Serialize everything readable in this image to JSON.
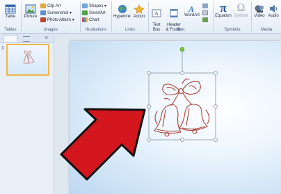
{
  "ribbon": {
    "tables": {
      "group": "Tables",
      "table": "Table"
    },
    "images": {
      "group": "Images",
      "picture": "Picture",
      "clip_art": "Clip Art",
      "screenshot": "Screenshot ▾",
      "photo_album": "Photo Album ▾"
    },
    "illustrations": {
      "group": "Illustrations",
      "shapes": "Shapes ▾",
      "smartart": "SmartArt",
      "chart": "Chart"
    },
    "links": {
      "group": "Links",
      "hyperlink": "Hyperlink",
      "action": "Action"
    },
    "text": {
      "group": "Text",
      "text_box": "Text\nBox",
      "header_footer": "Header\n& Footer",
      "wordart": "WordArt"
    },
    "symbols": {
      "group": "Symbols",
      "equation": "Equation",
      "symbol": "Symbol"
    },
    "media": {
      "group": "Media",
      "video": "Video",
      "audio": "Audio"
    }
  },
  "slides_panel": {
    "slide_number": "1"
  },
  "colors": {
    "arrow": "#d4161e",
    "selection": "#f0b64a",
    "handle_rotate": "#7fc241"
  }
}
